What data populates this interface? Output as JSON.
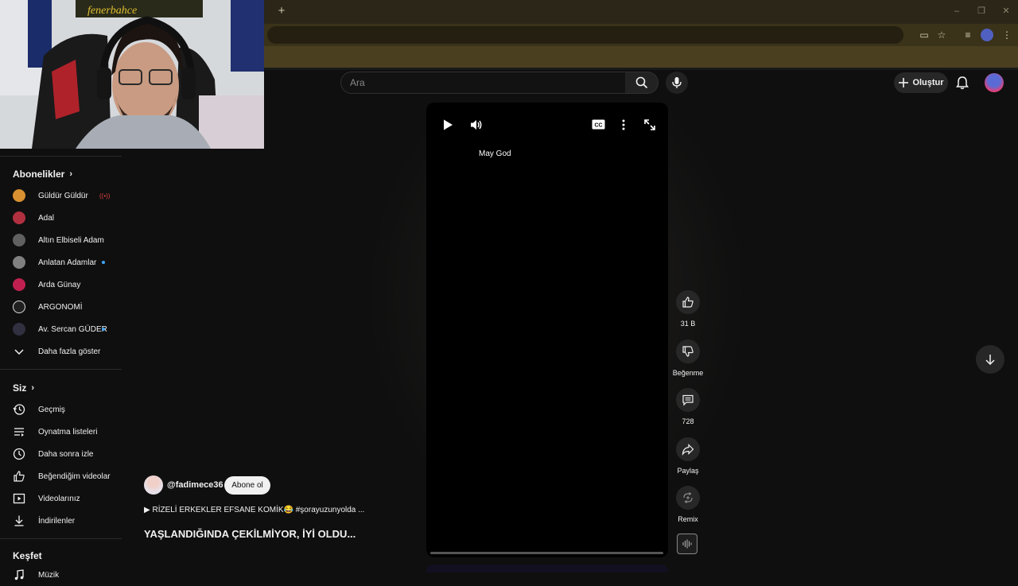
{
  "browser": {
    "new_tab": "+"
  },
  "search": {
    "placeholder": "Ara"
  },
  "header": {
    "create_label": "Oluştur"
  },
  "sidebar": {
    "subscriptions_title": "Abonelikler",
    "channels": [
      {
        "label": "Güldür Güldür",
        "color": "#d89030"
      },
      {
        "label": "Adal",
        "color": "#b03040"
      },
      {
        "label": "Altın Elbiseli Adam",
        "color": "#606060"
      },
      {
        "label": "Anlatan Adamlar",
        "color": "#808080"
      },
      {
        "label": "Arda Günay",
        "color": "#c02050"
      },
      {
        "label": "ARGONOMİ",
        "color": "#202020"
      },
      {
        "label": "Av. Sercan GÜDER",
        "color": "#303040"
      }
    ],
    "show_more": "Daha fazla göster",
    "you_title": "Siz",
    "you_items": [
      {
        "label": "Geçmiş",
        "icon": "history-icon"
      },
      {
        "label": "Oynatma listeleri",
        "icon": "playlist-icon"
      },
      {
        "label": "Daha sonra izle",
        "icon": "clock-icon"
      },
      {
        "label": "Beğendiğim videolar",
        "icon": "thumb-up-icon"
      },
      {
        "label": "Videolarınız",
        "icon": "video-icon"
      },
      {
        "label": "İndirilenler",
        "icon": "download-icon"
      }
    ],
    "explore_title": "Keşfet",
    "explore_items": [
      {
        "label": "Müzik"
      }
    ]
  },
  "player": {
    "caption": "May God",
    "progress": 0.0
  },
  "video": {
    "channel": "@fadimece36",
    "subscribe_label": "Abone ol",
    "description": "▶ RİZELİ ERKEKLER EFSANE KOMİK😂 #şorayuzunyolda ...",
    "title": "YAŞLANDIĞINDA ÇEKİLMİYOR, İYİ OLDU..."
  },
  "actions": {
    "likes": "31 B",
    "dislike": "Beğenme",
    "comments": "728",
    "share": "Paylaş",
    "remix": "Remix"
  }
}
